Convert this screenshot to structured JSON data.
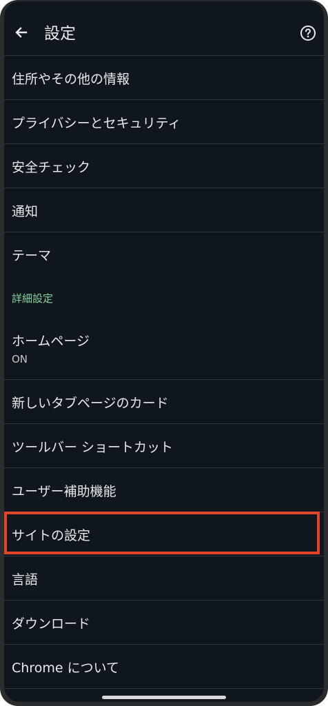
{
  "header": {
    "title": "設定",
    "back_icon": "arrow-left-icon",
    "help_icon": "help-circle-icon"
  },
  "settings": {
    "address": "住所やその他の情報",
    "privacy": "プライバシーとセキュリティ",
    "safety_check": "安全チェック",
    "notifications": "通知",
    "theme": "テーマ",
    "advanced_header": "詳細設定",
    "homepage": "ホームページ",
    "homepage_value": "ON",
    "ntp_cards": "新しいタブページのカード",
    "toolbar_shortcut": "ツールバー ショートカット",
    "accessibility": "ユーザー補助機能",
    "site_settings": "サイトの設定",
    "languages": "言語",
    "downloads": "ダウンロード",
    "about_chrome": "Chrome について"
  },
  "colors": {
    "background": "#0f161d",
    "text": "#e8eaed",
    "section_header": "#86d4a0",
    "highlight": "#e34427"
  }
}
